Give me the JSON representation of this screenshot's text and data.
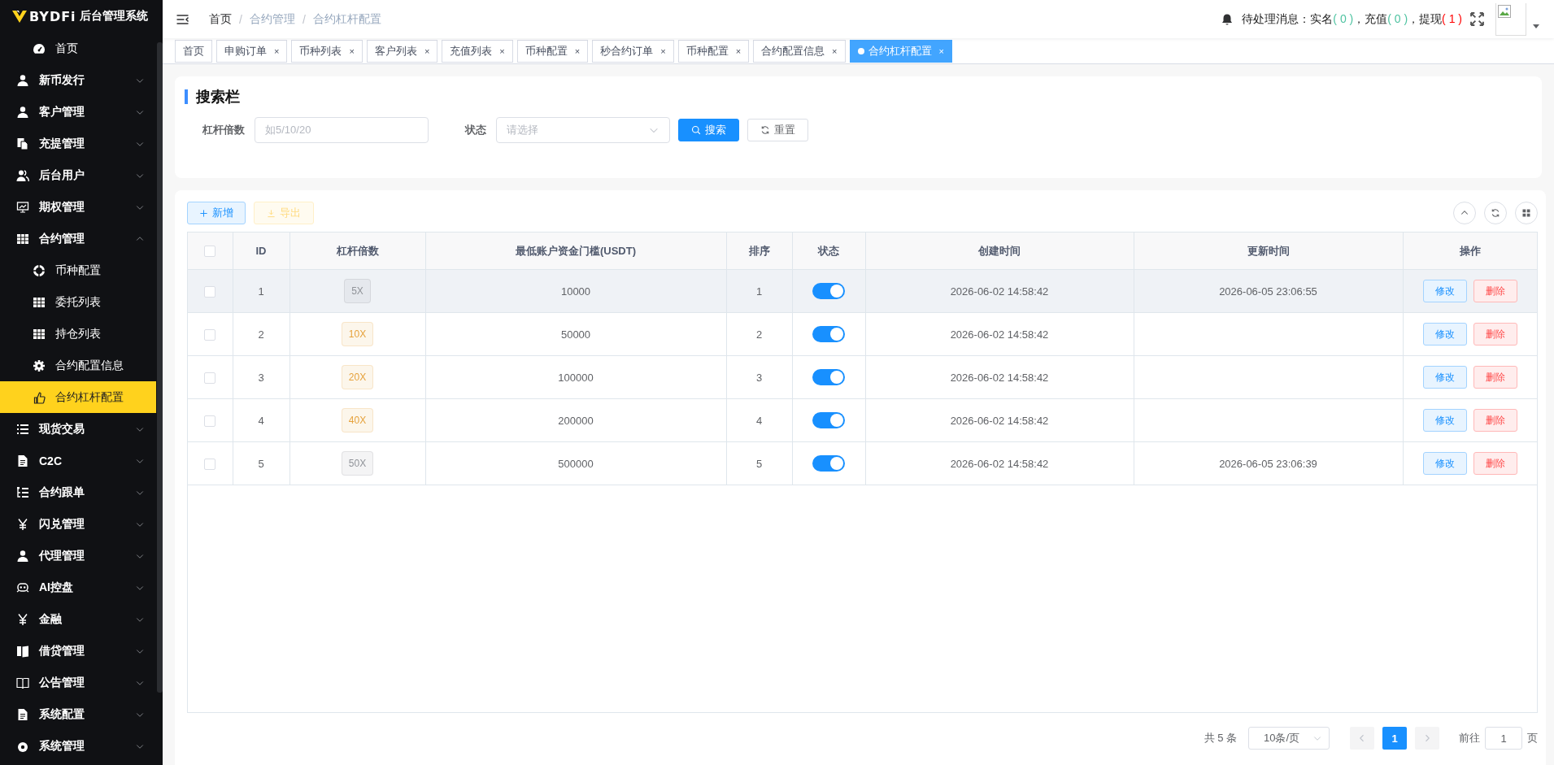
{
  "logo": {
    "brand": "BYDFi",
    "subtitle": "后台管理系统"
  },
  "sidebar": {
    "items": [
      {
        "label": "首页",
        "kind": "link"
      },
      {
        "label": "新币发行",
        "kind": "group",
        "expanded": false
      },
      {
        "label": "客户管理",
        "kind": "group",
        "expanded": false
      },
      {
        "label": "充提管理",
        "kind": "group",
        "expanded": false
      },
      {
        "label": "后台用户",
        "kind": "group",
        "expanded": false
      },
      {
        "label": "期权管理",
        "kind": "group",
        "expanded": false
      },
      {
        "label": "合约管理",
        "kind": "group",
        "expanded": true,
        "children": [
          {
            "label": "币种配置",
            "selected": false
          },
          {
            "label": "委托列表",
            "selected": false
          },
          {
            "label": "持仓列表",
            "selected": false
          },
          {
            "label": "合约配置信息",
            "selected": false
          },
          {
            "label": "合约杠杆配置",
            "selected": true
          }
        ]
      },
      {
        "label": "现货交易",
        "kind": "group",
        "expanded": false
      },
      {
        "label": "C2C",
        "kind": "group",
        "expanded": false
      },
      {
        "label": "合约跟单",
        "kind": "group",
        "expanded": false
      },
      {
        "label": "闪兑管理",
        "kind": "group",
        "expanded": false
      },
      {
        "label": "代理管理",
        "kind": "group",
        "expanded": false
      },
      {
        "label": "AI控盘",
        "kind": "group",
        "expanded": false
      },
      {
        "label": "金融",
        "kind": "group",
        "expanded": false
      },
      {
        "label": "借贷管理",
        "kind": "group",
        "expanded": false
      },
      {
        "label": "公告管理",
        "kind": "group",
        "expanded": false
      },
      {
        "label": "系统配置",
        "kind": "group",
        "expanded": false
      },
      {
        "label": "系统管理",
        "kind": "group",
        "expanded": false
      }
    ]
  },
  "header": {
    "breadcrumb": {
      "separator": "/",
      "items": [
        "首页",
        "合约管理",
        "合约杠杆配置"
      ]
    },
    "notice": {
      "prefix": "待处理消息：",
      "items": [
        {
          "label": "实名",
          "count": "( 0 )",
          "color": "#4fc3a1"
        },
        {
          "label": "，充值",
          "count": "( 0 )",
          "color": "#4fc3a1"
        },
        {
          "label": "，提现",
          "count": "( 1 )",
          "color": "#ff0000"
        }
      ]
    }
  },
  "tabs": [
    {
      "label": "首页",
      "selected": false
    },
    {
      "label": "申购订单",
      "selected": false,
      "close": "×"
    },
    {
      "label": "币种列表",
      "selected": false,
      "close": "×"
    },
    {
      "label": "客户列表",
      "selected": false,
      "close": "×"
    },
    {
      "label": "充值列表",
      "selected": false,
      "close": "×"
    },
    {
      "label": "币种配置",
      "selected": false,
      "close": "×"
    },
    {
      "label": "秒合约订单",
      "selected": false,
      "close": "×"
    },
    {
      "label": "币种配置",
      "selected": false,
      "close": "×"
    },
    {
      "label": "合约配置信息",
      "selected": false,
      "close": "×"
    },
    {
      "label": "合约杠杆配置",
      "selected": true,
      "close": "×"
    }
  ],
  "search": {
    "title": "搜索栏",
    "fields": [
      {
        "label": "杠杆倍数",
        "placeholder": "如5/10/20",
        "kind": "input"
      },
      {
        "label": "状态",
        "placeholder": "请选择",
        "kind": "select"
      }
    ],
    "buttons": [
      {
        "label": "搜索",
        "kind": "primary"
      },
      {
        "label": "重置",
        "kind": "default"
      }
    ]
  },
  "toolbar": {
    "buttons": [
      {
        "label": "新增",
        "kind": "add",
        "disabled": false
      },
      {
        "label": "导出",
        "kind": "export",
        "disabled": true
      }
    ]
  },
  "table": {
    "select_all_checked": false,
    "columns": [
      "ID",
      "杠杆倍数",
      "最低账户资金门槛(USDT)",
      "排序",
      "状态",
      "创建时间",
      "更新时间",
      "操作"
    ],
    "rows": [
      {
        "checked": false,
        "highlighted": true,
        "id": "1",
        "leverage": {
          "text": "5X",
          "color": "#909399"
        },
        "min_balance": "10000",
        "sort": "1",
        "status_on": true,
        "created": "2026-06-02 14:58:42",
        "updated": "2026-06-05 23:06:55",
        "actions": [
          "修改",
          "删除"
        ]
      },
      {
        "checked": false,
        "highlighted": false,
        "id": "2",
        "leverage": {
          "text": "10X",
          "color": "#e6a23c"
        },
        "min_balance": "50000",
        "sort": "2",
        "status_on": true,
        "created": "2026-06-02 14:58:42",
        "actions": [
          "修改",
          "删除"
        ]
      },
      {
        "checked": false,
        "highlighted": false,
        "id": "3",
        "leverage": {
          "text": "20X",
          "color": "#e6a23c"
        },
        "min_balance": "100000",
        "sort": "3",
        "status_on": true,
        "created": "2026-06-02 14:58:42",
        "actions": [
          "修改",
          "删除"
        ]
      },
      {
        "checked": false,
        "highlighted": false,
        "id": "4",
        "leverage": {
          "text": "40X",
          "color": "#e6a23c"
        },
        "min_balance": "200000",
        "sort": "4",
        "status_on": true,
        "created": "2026-06-02 14:58:42",
        "actions": [
          "修改",
          "删除"
        ]
      },
      {
        "checked": false,
        "highlighted": false,
        "id": "5",
        "leverage": {
          "text": "50X",
          "color": "#909399"
        },
        "min_balance": "500000",
        "sort": "5",
        "status_on": true,
        "created": "2026-06-02 14:58:42",
        "updated": "2026-06-05 23:06:39",
        "actions": [
          "修改",
          "删除"
        ]
      }
    ]
  },
  "pagination": {
    "total": "共 5 条",
    "page_size": "10条/页",
    "prev": {
      "disabled": true
    },
    "pages": [
      {
        "label": "1",
        "selected": true
      }
    ],
    "next": {
      "disabled": true
    },
    "goto_label": "前往",
    "goto_value": "1",
    "goto_suffix": "页"
  }
}
